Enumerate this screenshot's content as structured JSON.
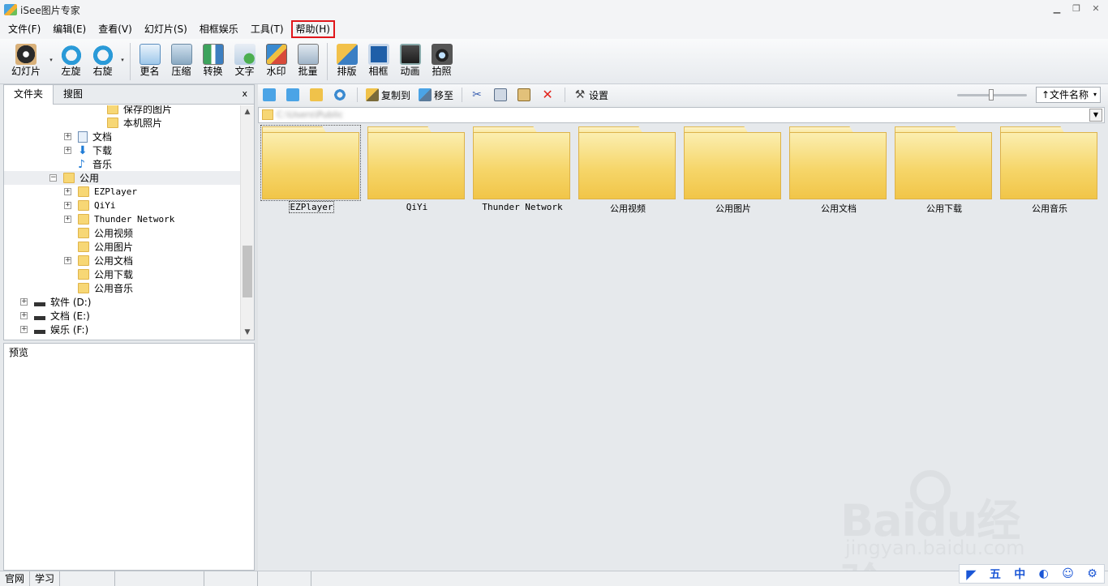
{
  "window": {
    "title": "iSee图片专家",
    "min": "▁",
    "restore": "❐",
    "close": "✕"
  },
  "menu": [
    "文件(F)",
    "编辑(E)",
    "查看(V)",
    "幻灯片(S)",
    "相框娱乐",
    "工具(T)",
    "帮助(H)"
  ],
  "toolbar": {
    "slideshow": "幻灯片",
    "rotate_left": "左旋",
    "rotate_right": "右旋",
    "rename": "更名",
    "compress": "压缩",
    "convert": "转换",
    "text": "文字",
    "watermark": "水印",
    "batch": "批量",
    "layout": "排版",
    "frame": "相框",
    "animation": "动画",
    "photo": "拍照",
    "dd": "▾"
  },
  "left_tabs": {
    "folder": "文件夹",
    "search": "搜图",
    "close": "x"
  },
  "tree": [
    {
      "label": "保存的图片",
      "indent": 4,
      "icon": "folder",
      "exp": ""
    },
    {
      "label": "本机照片",
      "indent": 4,
      "icon": "folder",
      "exp": ""
    },
    {
      "label": "文档",
      "indent": 3,
      "icon": "doc",
      "exp": "+"
    },
    {
      "label": "下载",
      "indent": 3,
      "icon": "download",
      "exp": "+"
    },
    {
      "label": "音乐",
      "indent": 3,
      "icon": "music",
      "exp": ""
    },
    {
      "label": "公用",
      "indent": 2,
      "icon": "folder",
      "exp": "−",
      "selected": true
    },
    {
      "label": "EZPlayer",
      "indent": 3,
      "icon": "folder",
      "exp": "+"
    },
    {
      "label": "QiYi",
      "indent": 3,
      "icon": "folder",
      "exp": "+"
    },
    {
      "label": "Thunder Network",
      "indent": 3,
      "icon": "folder",
      "exp": "+"
    },
    {
      "label": "公用视频",
      "indent": 3,
      "icon": "folder",
      "exp": ""
    },
    {
      "label": "公用图片",
      "indent": 3,
      "icon": "folder",
      "exp": ""
    },
    {
      "label": "公用文档",
      "indent": 3,
      "icon": "folder",
      "exp": "+"
    },
    {
      "label": "公用下载",
      "indent": 3,
      "icon": "folder",
      "exp": ""
    },
    {
      "label": "公用音乐",
      "indent": 3,
      "icon": "folder",
      "exp": ""
    },
    {
      "label": "软件 (D:)",
      "indent": 1,
      "icon": "drive",
      "exp": "+"
    },
    {
      "label": "文档 (E:)",
      "indent": 1,
      "icon": "drive",
      "exp": "+"
    },
    {
      "label": "娱乐 (F:)",
      "indent": 1,
      "icon": "drive",
      "exp": "+"
    }
  ],
  "scroll": {
    "up": "▲",
    "down": "▼"
  },
  "preview_label": "预览",
  "nav": {
    "copy_to": "复制到",
    "move_to": "移至",
    "settings": "设置",
    "cut": "✂",
    "delete": "✕",
    "gear": "⚒"
  },
  "sort": {
    "selected": "↑文件名称",
    "caret": "▾"
  },
  "path": {
    "value": "C:\\Users\\Public",
    "dd": "▼"
  },
  "folders": [
    "EZPlayer",
    "QiYi",
    "Thunder Network",
    "公用视频",
    "公用图片",
    "公用文档",
    "公用下载",
    "公用音乐"
  ],
  "status": [
    "官网",
    "学习",
    "",
    "",
    "",
    ""
  ],
  "watermark": {
    "brand": "Baidu经验",
    "url": "jingyan.baidu.com"
  },
  "ime": [
    "五",
    "中",
    "◐",
    "☺",
    "⚙"
  ]
}
